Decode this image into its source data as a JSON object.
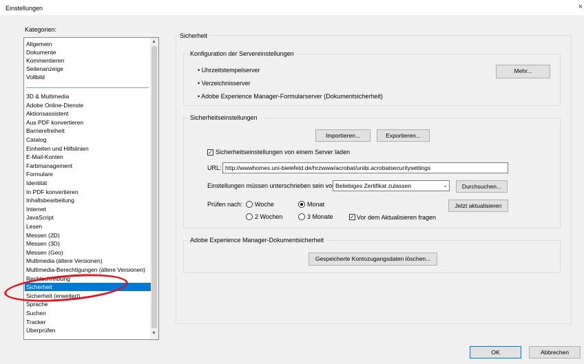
{
  "window": {
    "title": "Einstellungen",
    "close_glyph": "×"
  },
  "categories": {
    "label": "Kategorien:",
    "top_items": [
      "Allgemein",
      "Dokumente",
      "Kommentieren",
      "Seitenanzeige",
      "Vollbild"
    ],
    "items": [
      "3D & Multimedia",
      "Adobe Online-Dienste",
      "Aktionsassistent",
      "Aus PDF konvertieren",
      "Barrierefreiheit",
      "Catalog",
      "Einheiten und Hilfslinien",
      "E-Mail-Konten",
      "Farbmanagement",
      "Formulare",
      "Identität",
      "In PDF konvertieren",
      "Inhaltsbearbeitung",
      "Internet",
      "JavaScript",
      "Lesen",
      "Messen (2D)",
      "Messen (3D)",
      "Messen (Geo)",
      "Multimedia (ältere Versionen)",
      "Multimedia-Berechtigungen (ältere Versionen)",
      "Rechtschreibung",
      "Sicherheit",
      "Sicherheit (erweitert)",
      "Sprache",
      "Suchen",
      "Tracker",
      "Überprüfen"
    ],
    "selected": "Sicherheit",
    "highlight_color": "#e0141e"
  },
  "panel": {
    "title": "Sicherheit",
    "server": {
      "title": "Konfiguration der Servereinstellungen",
      "items": [
        "• Uhrzeitstempelserver",
        "• Verzeichnisserver",
        "• Adobe Experience Manager-Formularserver (Dokumentsicherheit)"
      ],
      "more_button": "Mehr..."
    },
    "security": {
      "title": "Sicherheitseinstellungen",
      "import_button": "Importieren...",
      "export_button": "Exportieren...",
      "load_from_server": {
        "label": "Sicherheitseinstellungen von einem Server laden",
        "checked": true
      },
      "url_label": "URL:",
      "url_value": "http://wwwhomes.uni-bielefeld.de/hrzwww/acrobat/unibi.acrobatsecuritysettings",
      "sign_label": "Einstellungen müssen unterschrieben sein von:",
      "sign_value": "Beliebiges Zertifikat zulassen",
      "browse_button": "Durchsuchen...",
      "check_label": "Prüfen nach:",
      "radios": [
        {
          "label": "Woche",
          "checked": false
        },
        {
          "label": "Monat",
          "checked": true
        },
        {
          "label": "2 Wochen",
          "checked": false
        },
        {
          "label": "3 Monate",
          "checked": false
        }
      ],
      "update_button": "Jetzt aktualisieren",
      "ask_before_update": {
        "label": "Vor dem Aktualisieren fragen",
        "checked": true
      }
    },
    "aem": {
      "title": "Adobe Experience Manager-Dokumentsicherheit",
      "delete_button": "Gespeicherte Kontozugangsdaten löschen..."
    }
  },
  "footer": {
    "ok": "OK",
    "cancel": "Abbrechen"
  }
}
